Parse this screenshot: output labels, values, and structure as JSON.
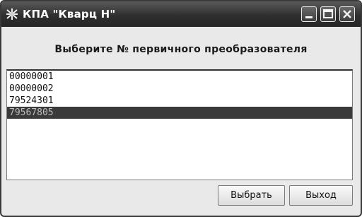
{
  "window": {
    "title": "КПА \"Кварц Н\"",
    "app_icon": "app-icon",
    "controls": [
      "minimize-icon",
      "maximize-icon",
      "close-icon"
    ]
  },
  "prompt": "Выберите № первичного преобразователя",
  "list": {
    "items": [
      "00000001",
      "00000002",
      "79524301",
      "79567805"
    ],
    "selected_index": 3,
    "selected_value": "79567805"
  },
  "buttons": {
    "select_label": "Выбрать",
    "exit_label": "Выход"
  },
  "colors": {
    "titlebar": "#2f2f2f",
    "selection_background": "#3a3a3a",
    "selection_text": "#bdbdbd",
    "window_background": "#e9e9e9"
  }
}
